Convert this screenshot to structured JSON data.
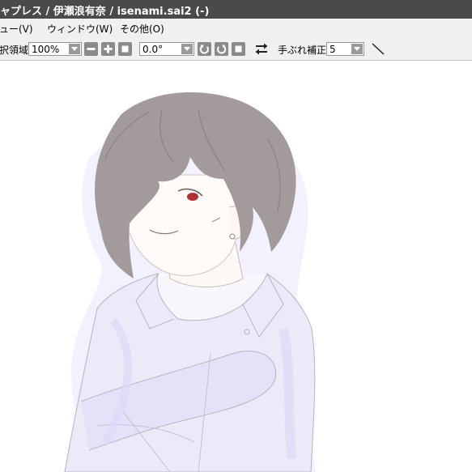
{
  "window": {
    "title": "ャプレス / 伊瀬浪有奈 / isenami.sai2 (-)"
  },
  "menu": {
    "items": [
      {
        "label": "ュー(V)"
      },
      {
        "label": "ウィンドウ(W)"
      },
      {
        "label": "その他(O)"
      }
    ]
  },
  "toolbar": {
    "area_label": "択領域",
    "zoom": {
      "value": "100%"
    },
    "rotation": {
      "value": "0.0°"
    },
    "stabilizer": {
      "label": "手ぶれ補正",
      "value": "5"
    }
  },
  "icons": {
    "zoom_out": "minus-icon",
    "zoom_in": "plus-icon",
    "zoom_reset": "square-icon",
    "rotate_ccw": "rotate-left-icon",
    "rotate_cw": "rotate-right-icon",
    "rotate_reset": "square-icon",
    "flip": "flip-horizontal-icon",
    "line_tool": "diagonal-line-icon"
  },
  "colors": {
    "titlebar_bg": "#4a4a4a",
    "chrome_bg": "#f0f0f0",
    "button_gray": "#8a8a8a",
    "canvas_bg": "#ffffff",
    "hair": "#a39a9c",
    "shirt_tint": "#e8e6fb",
    "eye": "#b03038"
  }
}
